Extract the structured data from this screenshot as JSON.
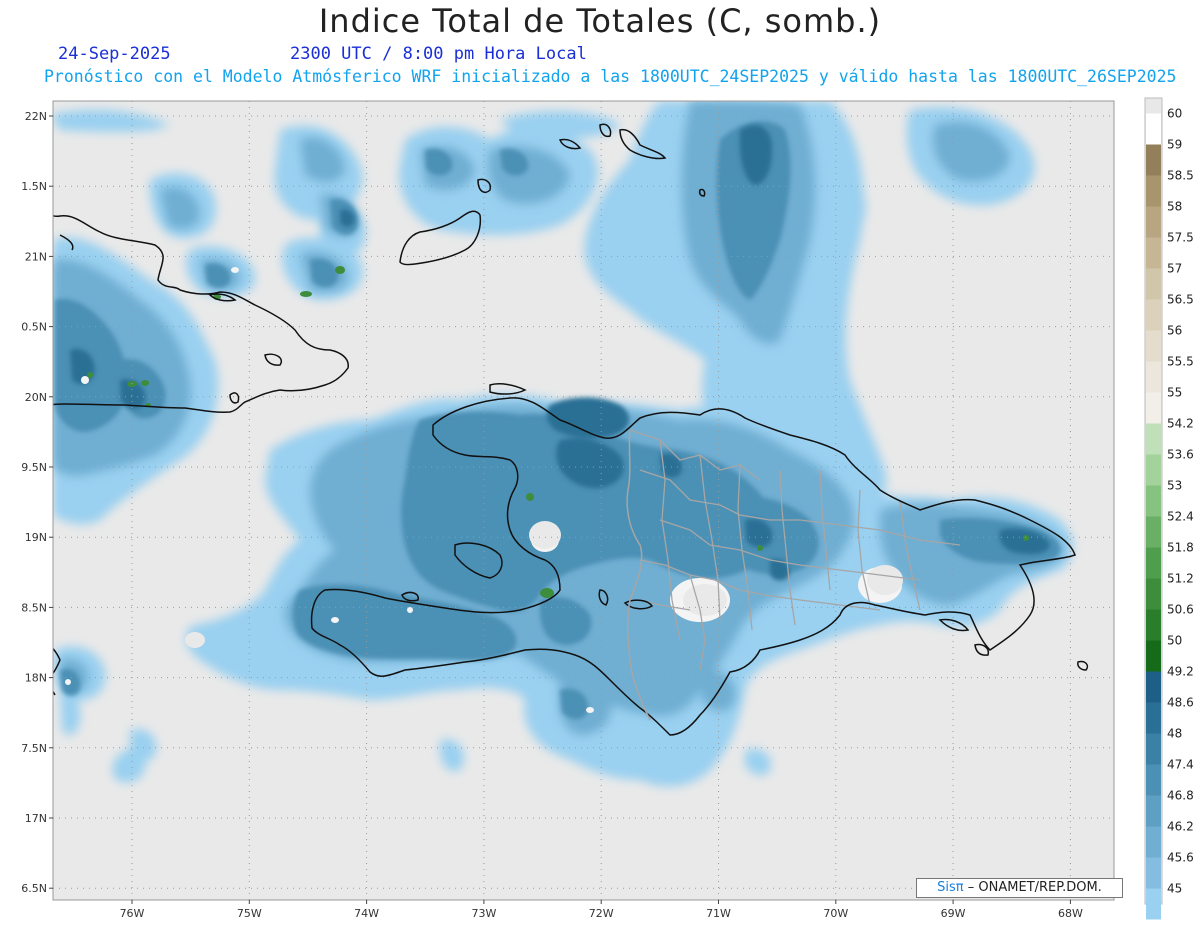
{
  "title": "Indice Total de Totales (C, somb.)",
  "date": "24-Sep-2025",
  "time": "2300 UTC / 8:00 pm Hora Local",
  "model": "Pronóstico con el Modelo Atmósferico WRF inicializado a las 1800UTC_24SEP2025 y válido hasta las  1800UTC_26SEP2025",
  "credit": {
    "brand": "Sisπ",
    "org": "– ONAMET/REP.DOM."
  },
  "axes": {
    "lon_labels": [
      "76W",
      "75W",
      "74W",
      "73W",
      "72W",
      "71W",
      "70W",
      "69W",
      "68W"
    ],
    "lat_labels": [
      "22N",
      "1.5N",
      "21N",
      "0.5N",
      "20N",
      "9.5N",
      "19N",
      "8.5N",
      "18N",
      "7.5N",
      "17N",
      "6.5N"
    ]
  },
  "colorbar": {
    "levels": [
      {
        "label": "60",
        "color": "#ffffff"
      },
      {
        "label": "59",
        "color": "#93805a"
      },
      {
        "label": "58.5",
        "color": "#a8946d"
      },
      {
        "label": "58",
        "color": "#b8a682"
      },
      {
        "label": "57.5",
        "color": "#c6b696"
      },
      {
        "label": "57",
        "color": "#d2c6aa"
      },
      {
        "label": "56.5",
        "color": "#dcd2bc"
      },
      {
        "label": "56",
        "color": "#e4ddcd"
      },
      {
        "label": "55.5",
        "color": "#ebe7dc"
      },
      {
        "label": "55",
        "color": "#f1efe8"
      },
      {
        "label": "54.2",
        "color": "#bfe0b8"
      },
      {
        "label": "53.6",
        "color": "#a3d29b"
      },
      {
        "label": "53",
        "color": "#86c280"
      },
      {
        "label": "52.4",
        "color": "#69b066"
      },
      {
        "label": "51.8",
        "color": "#4f9e4e"
      },
      {
        "label": "51.2",
        "color": "#3d8d3c"
      },
      {
        "label": "50.6",
        "color": "#2a7d2b"
      },
      {
        "label": "50",
        "color": "#166b1a"
      },
      {
        "label": "49.2",
        "color": "#1d5f86"
      },
      {
        "label": "48.6",
        "color": "#2a6f95"
      },
      {
        "label": "48",
        "color": "#3b80a5"
      },
      {
        "label": "47.4",
        "color": "#4c90b5"
      },
      {
        "label": "46.8",
        "color": "#5e9fc4"
      },
      {
        "label": "46.2",
        "color": "#70aed2"
      },
      {
        "label": "45.6",
        "color": "#84bde0"
      },
      {
        "label": "45",
        "color": "#9ad0f0"
      }
    ]
  },
  "colors": {
    "background": "#e9e9e9",
    "coast": "#111111",
    "provinces": "#a6a6a6",
    "grid": "#9a9a9a"
  }
}
